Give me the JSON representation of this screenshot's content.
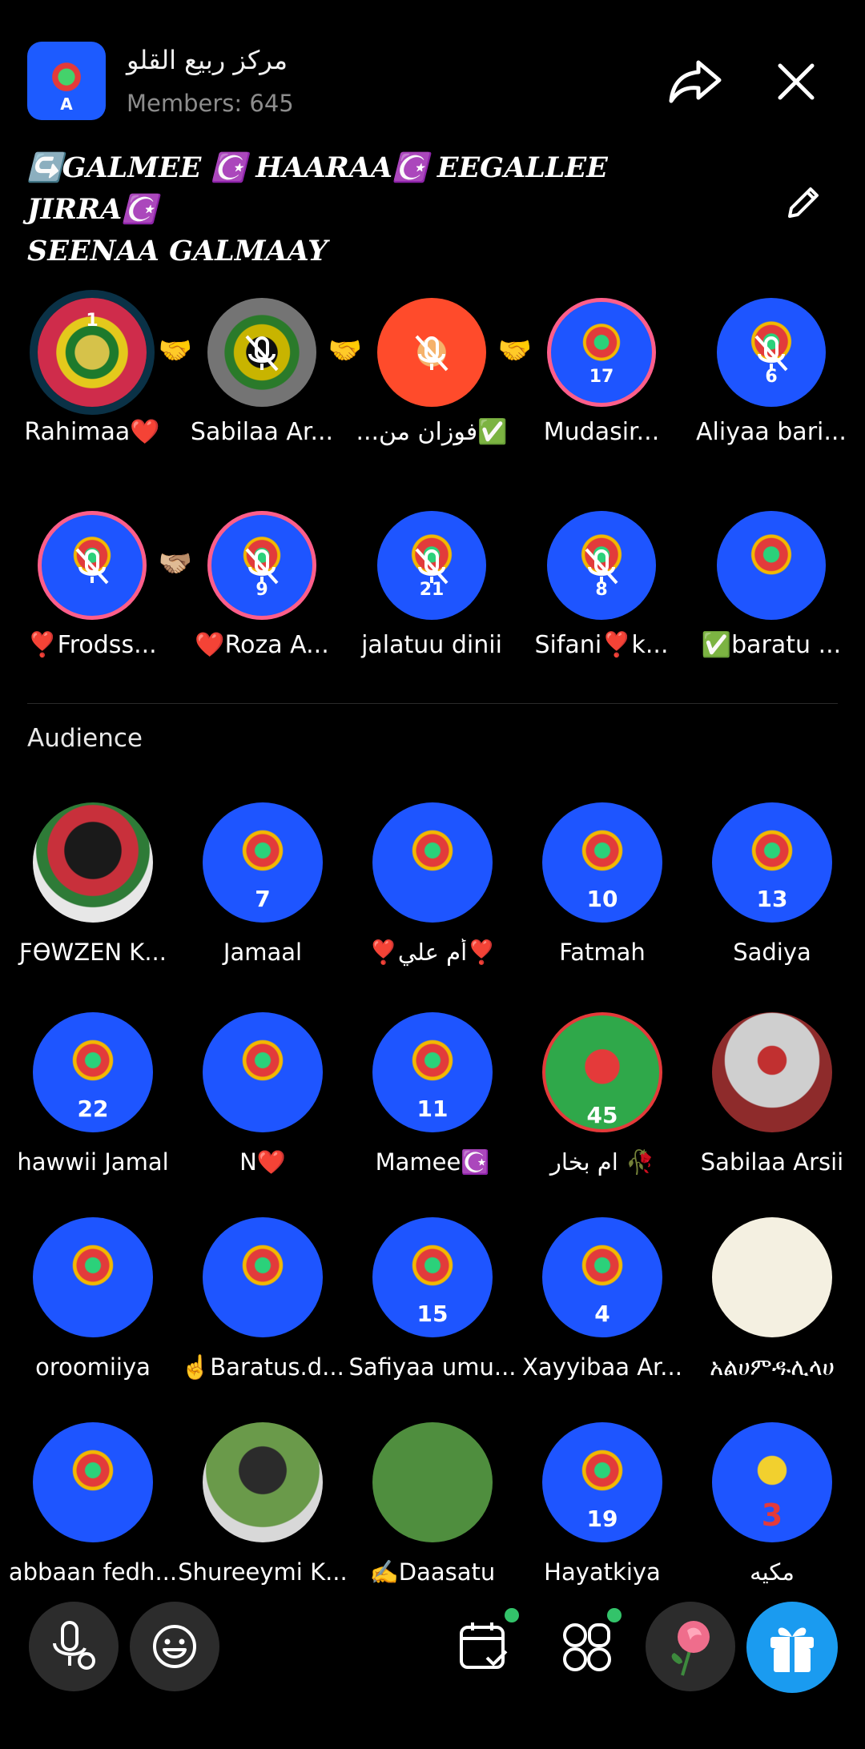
{
  "header": {
    "group_name": "مركز ربيع القلو",
    "members": "Members: 645"
  },
  "topic": {
    "line1": "↪️GALMEE ☪️ HAARAA☪️ EEGALLEE JIRRA☪️",
    "line2": "SEENAA GALMAAY"
  },
  "seats": [
    {
      "label": "Rahimaa❤️",
      "badge": "1",
      "muted": false,
      "style": "gold"
    },
    {
      "label": "Sabilaa Ar...",
      "badge": "",
      "muted": true,
      "style": "grey"
    },
    {
      "label": "...فوزان من✅",
      "badge": "",
      "muted": true,
      "style": "orange"
    },
    {
      "label": "Mudasir...",
      "badge": "17",
      "muted": false,
      "style": "pink"
    },
    {
      "label": "Aliyaa bari...",
      "badge": "6",
      "muted": true,
      "style": "plain"
    },
    {
      "label": "❣️Frodss...",
      "badge": "",
      "muted": true,
      "style": "pink"
    },
    {
      "label": "❤️Roza A...",
      "badge": "9",
      "muted": true,
      "style": "pink"
    },
    {
      "label": "jalatuu dinii",
      "badge": "21",
      "muted": true,
      "style": "plain"
    },
    {
      "label": "Sifani❣️k...",
      "badge": "8",
      "muted": true,
      "style": "plain"
    },
    {
      "label": "✅baratu ...",
      "badge": "",
      "muted": false,
      "style": "plain"
    }
  ],
  "links": [
    "🤝",
    "🤝",
    "🤝",
    "🫱🏼‍🫲🏽"
  ],
  "audience_title": "Audience",
  "audience": [
    {
      "label": "ƑƟWZEN K...",
      "num": "",
      "style": "photo-a"
    },
    {
      "label": "Jamaal",
      "num": "7",
      "style": "logo"
    },
    {
      "label": "❣️أم علي❣️",
      "num": "",
      "style": "logo"
    },
    {
      "label": "Fatmah",
      "num": "10",
      "style": "logo"
    },
    {
      "label": "Sadiya",
      "num": "13",
      "style": "logo"
    },
    {
      "label": "hawwii Jamal",
      "num": "22",
      "style": "logo"
    },
    {
      "label": "N❤️",
      "num": "",
      "style": "logo"
    },
    {
      "label": "Mamee☪️",
      "num": "11",
      "style": "logo"
    },
    {
      "label": "ام بخار 🥀",
      "num": "45",
      "style": "photo-b"
    },
    {
      "label": "Sabilaa Arsii",
      "num": "",
      "style": "photo-c"
    },
    {
      "label": "oroomiiya",
      "num": "",
      "style": "logo"
    },
    {
      "label": "☝️Baratus.d...",
      "num": "",
      "style": "logo"
    },
    {
      "label": "Safiyaa umu...",
      "num": "15",
      "style": "logo"
    },
    {
      "label": "Xayyibaa Ar...",
      "num": "4",
      "style": "logo"
    },
    {
      "label": "አልሀምዱሊላሀ",
      "num": "",
      "style": "photo-d"
    },
    {
      "label": "abbaan fedh...",
      "num": "",
      "style": "logo"
    },
    {
      "label": "Shureeymi K...",
      "num": "",
      "style": "photo-e"
    },
    {
      "label": "✍️Daasatu",
      "num": "",
      "style": "photo-f"
    },
    {
      "label": "Hayatkiya",
      "num": "19",
      "style": "logo"
    },
    {
      "label": "مكيه",
      "num": "3",
      "style": "photo-g"
    }
  ],
  "icons": {
    "share": "share-icon",
    "close": "close-icon",
    "edit": "pencil-icon",
    "mic": "mic-settings-icon",
    "emoji": "emoji-icon",
    "calendar": "calendar-check-icon",
    "apps": "apps-icon",
    "rose": "rose-icon",
    "gift": "gift-icon"
  },
  "colors": {
    "gift": "#1a9bf0",
    "notification_dot": "#33c36a",
    "seat_ring": "#ff5e8a"
  }
}
